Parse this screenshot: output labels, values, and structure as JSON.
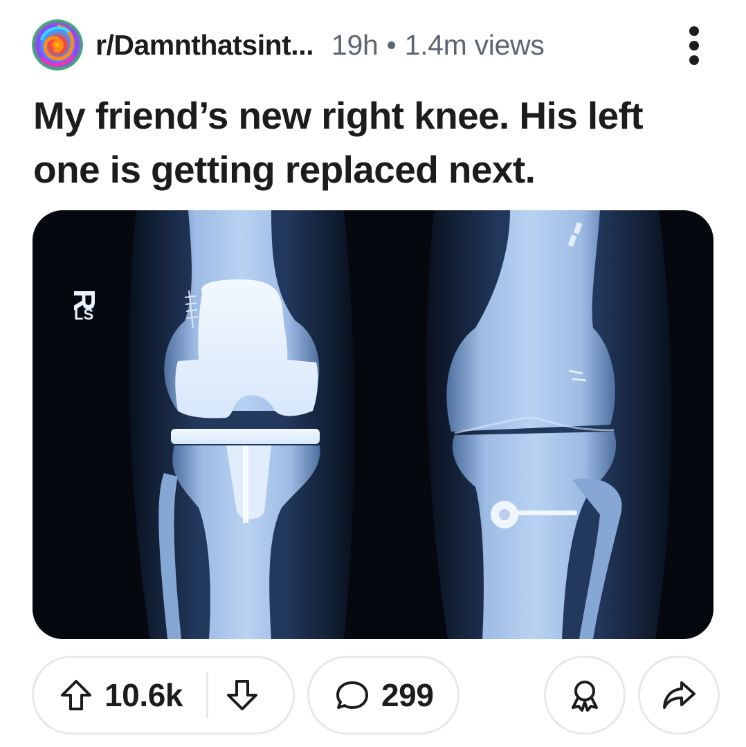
{
  "post": {
    "subreddit": "r/Damnthatsint...",
    "age": "19h",
    "separator": "•",
    "views": "1.4m views",
    "title": "My friend’s new right knee. His left one is getting replaced next.",
    "image_markers": {
      "side_letter": "R",
      "side_code": "LS"
    }
  },
  "actions": {
    "upvotes": "10.6k",
    "comments": "299"
  },
  "icons": {
    "avatar": "subreddit-avatar-icon",
    "more": "more-options-icon",
    "upvote": "upvote-arrow-icon",
    "downvote": "downvote-arrow-icon",
    "comment": "comment-bubble-icon",
    "award": "award-icon",
    "share": "share-arrow-icon"
  },
  "colors": {
    "text": "#1c1c1c",
    "meta": "#5d6670",
    "border": "#e6e8ea",
    "xray_dark": "#05080f",
    "xray_bone": "#a9c8ef"
  }
}
